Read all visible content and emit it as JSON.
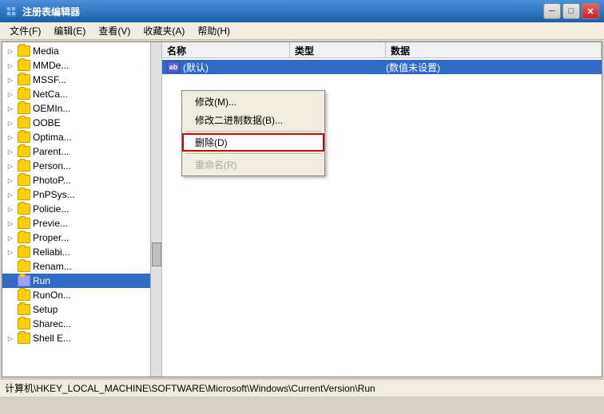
{
  "title_bar": {
    "title": "注册表编辑器",
    "min_label": "─",
    "max_label": "□",
    "close_label": "✕"
  },
  "menu": {
    "items": [
      "文件(F)",
      "编辑(E)",
      "查看(V)",
      "收藏夹(A)",
      "帮助(H)"
    ]
  },
  "columns": {
    "name": "名称",
    "type": "类型",
    "data": "数据"
  },
  "tree_items": [
    {
      "label": "Media",
      "indent": 1,
      "has_arrow": true
    },
    {
      "label": "MMDe...",
      "indent": 1,
      "has_arrow": true
    },
    {
      "label": "MSSF...",
      "indent": 1,
      "has_arrow": true
    },
    {
      "label": "NetCa...",
      "indent": 1,
      "has_arrow": true
    },
    {
      "label": "OEMIn...",
      "indent": 1,
      "has_arrow": true
    },
    {
      "label": "OOBE",
      "indent": 1,
      "has_arrow": true
    },
    {
      "label": "Optima...",
      "indent": 1,
      "has_arrow": true
    },
    {
      "label": "Parent...",
      "indent": 1,
      "has_arrow": true
    },
    {
      "label": "Person...",
      "indent": 1,
      "has_arrow": true
    },
    {
      "label": "PhotoP...",
      "indent": 1,
      "has_arrow": true
    },
    {
      "label": "PnPSys...",
      "indent": 1,
      "has_arrow": true
    },
    {
      "label": "Policie...",
      "indent": 1,
      "has_arrow": true
    },
    {
      "label": "Previe...",
      "indent": 1,
      "has_arrow": true
    },
    {
      "label": "Proper...",
      "indent": 1,
      "has_arrow": true
    },
    {
      "label": "Reliabi...",
      "indent": 1,
      "has_arrow": true
    },
    {
      "label": "Renam...",
      "indent": 1,
      "has_arrow": false
    },
    {
      "label": "Run",
      "indent": 1,
      "has_arrow": false,
      "selected": true
    },
    {
      "label": "RunOn...",
      "indent": 1,
      "has_arrow": false
    },
    {
      "label": "Setup",
      "indent": 1,
      "has_arrow": false
    },
    {
      "label": "Sharec...",
      "indent": 1,
      "has_arrow": false
    },
    {
      "label": "Shell E...",
      "indent": 1,
      "has_arrow": true
    }
  ],
  "data_rows": [
    {
      "name": "(默认)",
      "type": "",
      "value": "(数值未设置)"
    }
  ],
  "context_menu": {
    "items": [
      {
        "label": "修改(M)...",
        "type": "normal"
      },
      {
        "label": "修改二进制数据(B)...",
        "type": "normal"
      },
      {
        "label": "删除(D)",
        "type": "highlighted"
      },
      {
        "label": "重命名(R)",
        "type": "disabled"
      }
    ]
  },
  "status_bar": {
    "text": "计算机\\HKEY_LOCAL_MACHINE\\SOFTWARE\\Microsoft\\Windows\\CurrentVersion\\Run"
  }
}
